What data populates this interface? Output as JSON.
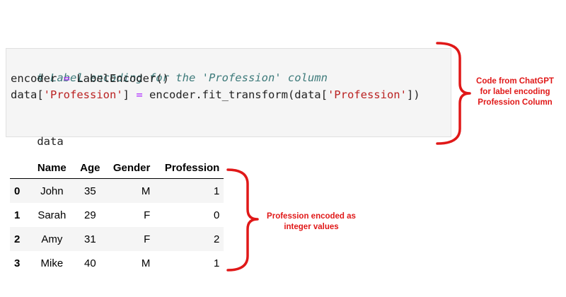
{
  "code_cell": {
    "line1_comment": "# Label encoding for the 'Profession' column",
    "line2_var": "encoder ",
    "line2_op": "=",
    "line2_rest": " LabelEncoder()",
    "line3_a": "data[",
    "line3_str": "'Profession'",
    "line3_b": "] ",
    "line3_op": "=",
    "line3_c": " encoder.fit_transform(data[",
    "line3_str2": "'Profession'",
    "line3_d": "])",
    "line5": "data"
  },
  "annotations": {
    "code_note": "Code from ChatGPT for label encoding Profession Column",
    "table_note": "Profession encoded as integer values"
  },
  "table": {
    "columns": [
      "Name",
      "Age",
      "Gender",
      "Profession"
    ],
    "rows": [
      {
        "index": "0",
        "name": "John",
        "age": "35",
        "gender": "M",
        "profession": "1"
      },
      {
        "index": "1",
        "name": "Sarah",
        "age": "29",
        "gender": "F",
        "profession": "0"
      },
      {
        "index": "2",
        "name": "Amy",
        "age": "31",
        "gender": "F",
        "profession": "2"
      },
      {
        "index": "3",
        "name": "Mike",
        "age": "40",
        "gender": "M",
        "profession": "1"
      }
    ]
  },
  "colors": {
    "annotation_red": "#e01818",
    "comment": "#3d7a7a",
    "operator": "#aa22ff",
    "string": "#ba2121",
    "cell_bg": "#f5f5f5"
  }
}
